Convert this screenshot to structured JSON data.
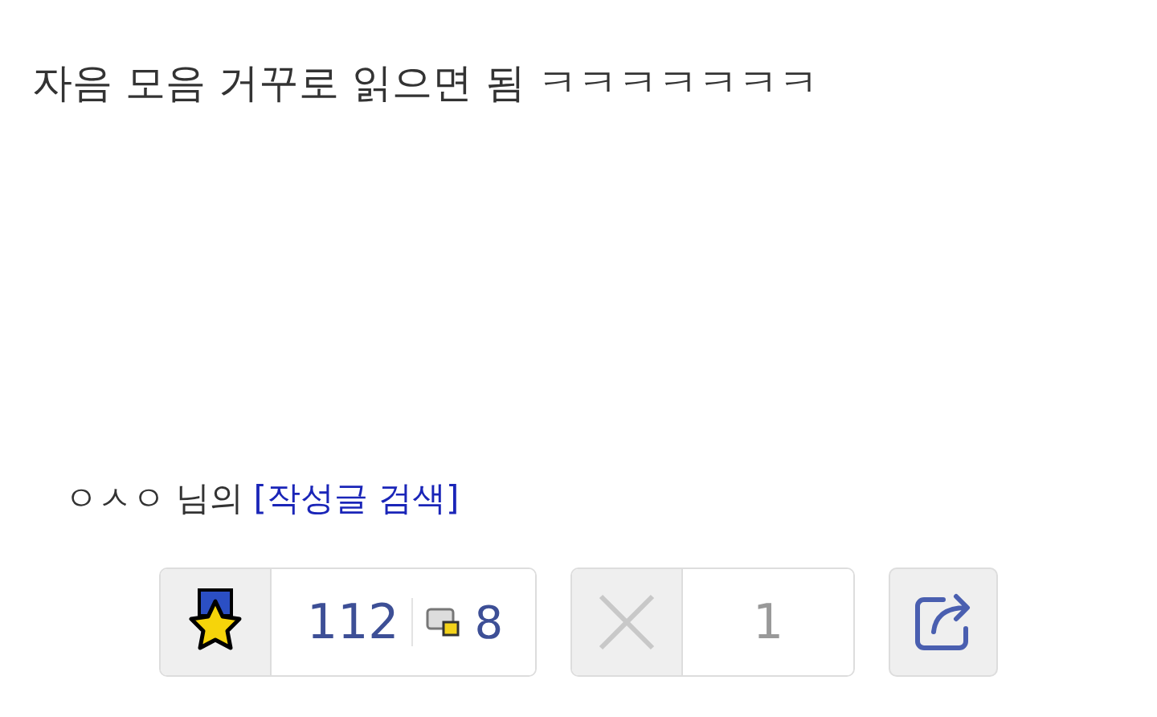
{
  "post": {
    "body": "자음 모음 거꾸로 읽으면 됨 ㅋㅋㅋㅋㅋㅋㅋ"
  },
  "author": {
    "name": "ㅇㅅㅇ 님의",
    "search_link": "[작성글 검색]"
  },
  "actions": {
    "recommend_count": "112",
    "comment_count": "8",
    "dislike_count": "1"
  }
}
